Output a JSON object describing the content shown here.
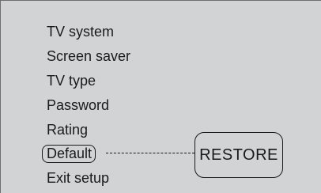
{
  "menu": {
    "items": [
      {
        "label": "TV system"
      },
      {
        "label": "Screen saver"
      },
      {
        "label": "TV type"
      },
      {
        "label": "Password"
      },
      {
        "label": "Rating"
      },
      {
        "label": "Default",
        "selected": true
      },
      {
        "label": "Exit setup"
      }
    ]
  },
  "submenu": {
    "option_label": "RESTORE"
  },
  "colors": {
    "screen_background": "#d2d3d5",
    "text": "#1a1a1a",
    "frame_border": "#6e6e6e"
  }
}
